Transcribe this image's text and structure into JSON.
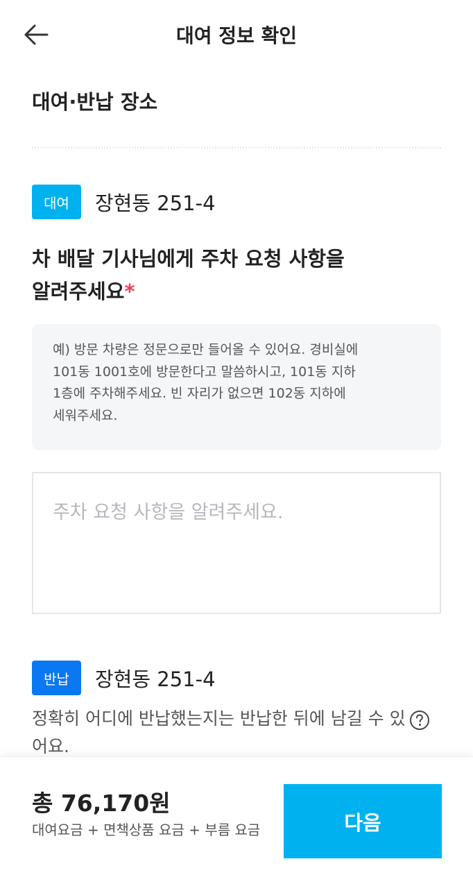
{
  "header": {
    "title": "대여 정보 확인",
    "back_icon": "arrow-left-icon"
  },
  "location_section": {
    "title": "대여·반납 장소"
  },
  "pickup": {
    "badge": "대여",
    "badge_color": "#00b1f0",
    "address": "장현동 251-4"
  },
  "parking_request": {
    "title_line1": "차 배달 기사님에게 주차 요청 사항을",
    "title_line2": "알려주세요",
    "required_mark": "*",
    "example_lines": [
      "예) 방문 차량은 정문으로만 들어올 수 있어요. 경비실에",
      "101동 1001호에 방문한다고 말씀하시고, 101동 지하",
      "1층에 주차해주세요. 빈 자리가 없으면 102동 지하에",
      "세워주세요."
    ],
    "input_placeholder": "주차 요청 사항을 알려주세요.",
    "input_value": ""
  },
  "return": {
    "badge": "반납",
    "badge_color": "#0a78f0",
    "address": "장현동 251-4",
    "note": "정확히 어디에 반납했는지는 반납한 뒤에 남길 수 있어요.",
    "help_icon": "question-circle-icon"
  },
  "footer": {
    "total": "총 76,170원",
    "fee_description": "대여요금 + 면책상품 요금 + 부름 요금",
    "next_button": "다음",
    "accent_color": "#00b1f0"
  }
}
